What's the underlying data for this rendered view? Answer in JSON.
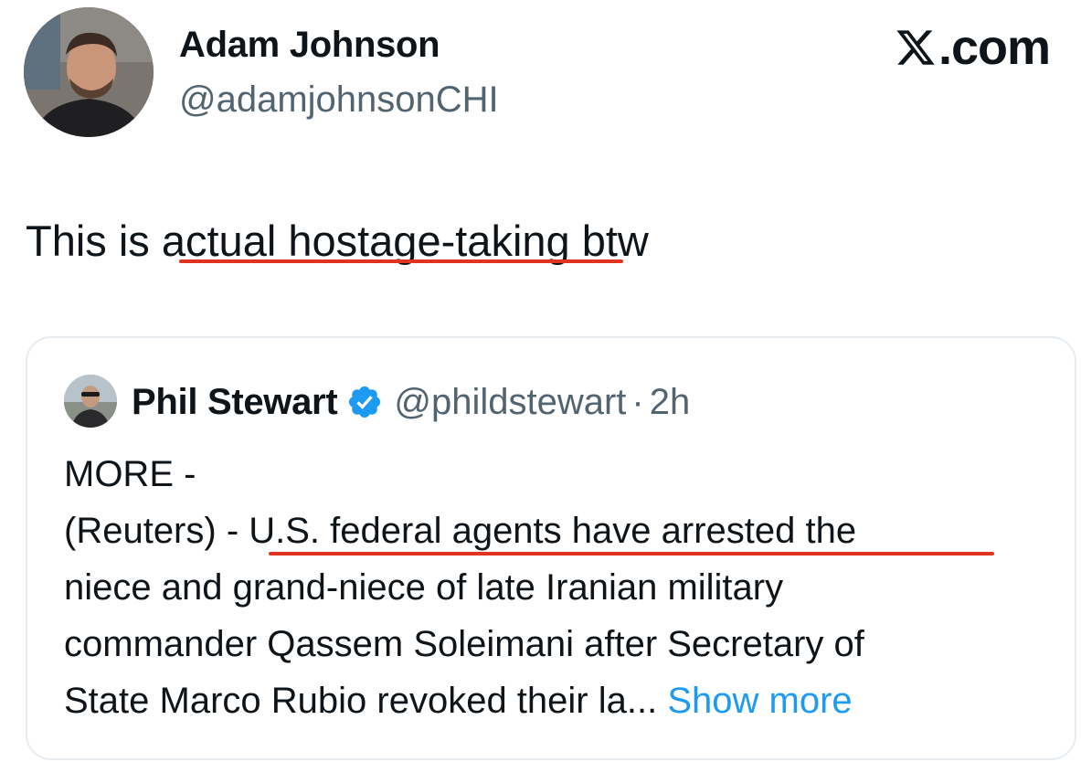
{
  "author": {
    "name": "Adam Johnson",
    "handle": "@adamjohnsonCHI"
  },
  "brand": {
    "label": ".com",
    "logo_icon": "x-logo-icon"
  },
  "tweet": {
    "text_before": "This is ",
    "text_highlight": "actual hostage-taking",
    "text_after": " btw"
  },
  "quote": {
    "author_name": "Phil Stewart",
    "verified_icon": "verified-badge-icon",
    "handle": "@phildstewart",
    "separator": "·",
    "time": "2h",
    "lines": [
      "MORE -",
      "(Reuters) - U.S. federal agents have arrested the",
      "niece and grand-niece of late Iranian military",
      "commander Qassem Soleimani after Secretary of",
      "State Marco Rubio revoked their la..."
    ],
    "show_more": "Show more"
  },
  "colors": {
    "text": "#0f1419",
    "secondary": "#536471",
    "link": "#1d9bf0",
    "verified": "#1d9bf0",
    "annotation_underline": "#e0341f",
    "card_border": "#e6ecf0"
  }
}
